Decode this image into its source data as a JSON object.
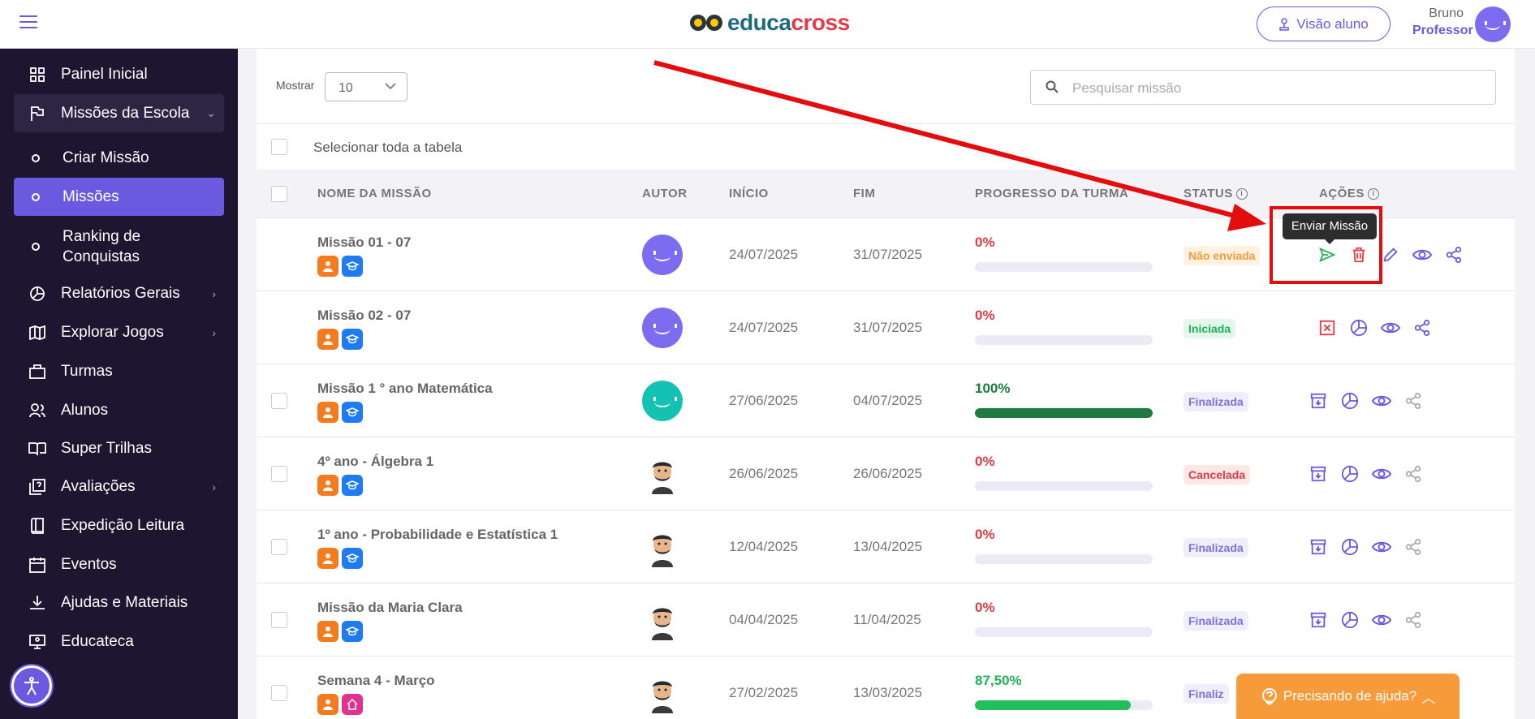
{
  "header": {
    "logo_part1": "educa",
    "logo_part2": "cross",
    "view_student_label": "Visão aluno",
    "user_name": "Bruno",
    "user_role": "Professor"
  },
  "sidebar": {
    "items": [
      {
        "label": "Painel Inicial",
        "icon": "grid-icon"
      },
      {
        "label": "Missões da Escola",
        "icon": "flag-icon"
      },
      {
        "label": "Criar Missão",
        "icon": "circle-icon"
      },
      {
        "label": "Missões",
        "icon": "circle-icon"
      },
      {
        "label": "Ranking de Conquistas",
        "icon": "circle-icon"
      },
      {
        "label": "Relatórios Gerais",
        "icon": "pie-chart-icon"
      },
      {
        "label": "Explorar Jogos",
        "icon": "map-icon"
      },
      {
        "label": "Turmas",
        "icon": "briefcase-icon"
      },
      {
        "label": "Alunos",
        "icon": "users-icon"
      },
      {
        "label": "Super Trilhas",
        "icon": "book-open-icon"
      },
      {
        "label": "Avaliações",
        "icon": "quiz-icon"
      },
      {
        "label": "Expedição Leitura",
        "icon": "book-icon"
      },
      {
        "label": "Eventos",
        "icon": "calendar-icon"
      },
      {
        "label": "Ajudas e Materiais",
        "icon": "download-icon"
      },
      {
        "label": "Educateca",
        "icon": "screen-icon"
      }
    ]
  },
  "controls": {
    "show_label": "Mostrar",
    "show_value": "10",
    "search_placeholder": "Pesquisar missão",
    "select_all_label": "Selecionar toda a tabela"
  },
  "table": {
    "headers": {
      "name": "NOME DA MISSÃO",
      "author": "AUTOR",
      "start": "INÍCIO",
      "end": "FIM",
      "progress": "PROGRESSO DA TURMA",
      "status": "STATUS",
      "actions": "AÇÕES"
    },
    "rows": [
      {
        "name": "Missão 01 - 07",
        "start": "24/07/2025",
        "end": "31/07/2025",
        "progress_label": "0%",
        "progress": 0,
        "status": "Não enviada"
      },
      {
        "name": "Missão 02 - 07",
        "start": "24/07/2025",
        "end": "31/07/2025",
        "progress_label": "0%",
        "progress": 0,
        "status": "Iniciada"
      },
      {
        "name": "Missão 1 ° ano Matemática",
        "start": "27/06/2025",
        "end": "04/07/2025",
        "progress_label": "100%",
        "progress": 100,
        "status": "Finalizada"
      },
      {
        "name": "4º ano - Álgebra 1",
        "start": "26/06/2025",
        "end": "26/06/2025",
        "progress_label": "0%",
        "progress": 0,
        "status": "Cancelada"
      },
      {
        "name": "1º ano - Probabilidade e Estatística 1",
        "start": "12/04/2025",
        "end": "13/04/2025",
        "progress_label": "0%",
        "progress": 0,
        "status": "Finalizada"
      },
      {
        "name": "Missão da Maria Clara",
        "start": "04/04/2025",
        "end": "11/04/2025",
        "progress_label": "0%",
        "progress": 0,
        "status": "Finalizada"
      },
      {
        "name": "Semana 4 - Março",
        "start": "27/02/2025",
        "end": "13/03/2025",
        "progress_label": "87,50%",
        "progress": 87.5,
        "status": "Finaliz"
      }
    ]
  },
  "tooltip": "Enviar Missão",
  "help_label": "Precisando de ajuda?",
  "colors": {
    "accent": "#6a5ae0",
    "sidebar_bg": "#1e1530",
    "annotation_red": "#e30d0d"
  }
}
